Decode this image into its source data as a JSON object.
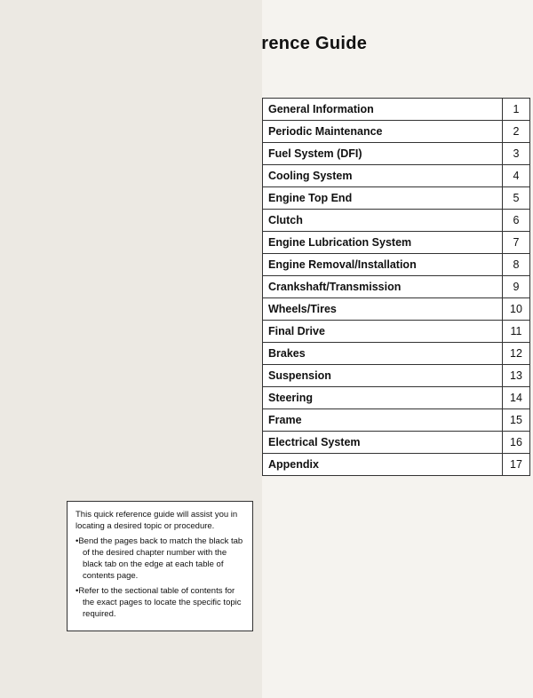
{
  "page": {
    "title": "Quick Reference Guide",
    "toc": {
      "items": [
        {
          "label": "General Information",
          "number": "1"
        },
        {
          "label": "Periodic Maintenance",
          "number": "2"
        },
        {
          "label": "Fuel System (DFI)",
          "number": "3"
        },
        {
          "label": "Cooling System",
          "number": "4"
        },
        {
          "label": "Engine Top End",
          "number": "5"
        },
        {
          "label": "Clutch",
          "number": "6"
        },
        {
          "label": "Engine Lubrication System",
          "number": "7"
        },
        {
          "label": "Engine Removal/Installation",
          "number": "8"
        },
        {
          "label": "Crankshaft/Transmission",
          "number": "9"
        },
        {
          "label": "Wheels/Tires",
          "number": "10"
        },
        {
          "label": "Final Drive",
          "number": "11"
        },
        {
          "label": "Brakes",
          "number": "12"
        },
        {
          "label": "Suspension",
          "number": "13"
        },
        {
          "label": "Steering",
          "number": "14"
        },
        {
          "label": "Frame",
          "number": "15"
        },
        {
          "label": "Electrical System",
          "number": "16"
        },
        {
          "label": "Appendix",
          "number": "17"
        }
      ]
    },
    "note": {
      "line1": "This quick reference guide will assist you in locating a desired topic or procedure.",
      "bullet1": "•Bend the pages back to match the black tab of the desired chapter number with the black tab on the edge at each table of contents page.",
      "bullet2": "•Refer to the sectional table of contents for the exact pages to locate the specific topic required."
    }
  }
}
